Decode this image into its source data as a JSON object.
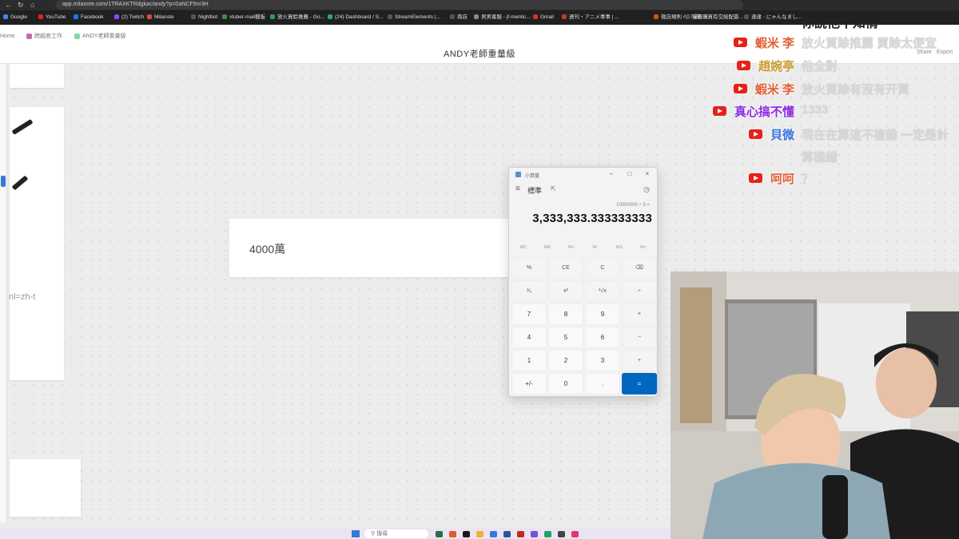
{
  "browser": {
    "url": "app.milanote.com/1TRAXKTRdgkac/andy?p=0aNCF5nr3H",
    "bookmarks": [
      "Google",
      "YouTube",
      "Facebook",
      "(2) Twitch",
      "Milanote",
      "Nightbot",
      "vtuber-mail模板",
      "放火買賒推薦 - Go...",
      "(24) Dashboard / S...",
      "StreamElements |...",
      "商店",
      "男男客服 - jf-mentic...",
      "Gmail",
      "週刊・アニメ事事 | ...",
      "微店規則 4.470年...",
      "漫畫購買有交給配簽...",
      "達達 - にゃんなまし..."
    ]
  },
  "app": {
    "breadcrumbs": [
      "Home",
      "跨組底工作",
      "ANDY老師重量級"
    ],
    "board_title": "ANDY老師重量級",
    "share_label": "Share",
    "export_label": "Export",
    "note_text": "4000萬",
    "left_partial_text": "nl=zh-t"
  },
  "calculator": {
    "title": "小算盤",
    "mode": "標準",
    "expression": "10000000 ÷ 3 =",
    "result": "3,333,333.333333333",
    "memory_keys": [
      "MC",
      "MR",
      "M+",
      "M-",
      "MS",
      "M˅"
    ],
    "keys": [
      [
        "%",
        "CE",
        "C",
        "⌫"
      ],
      [
        "¹⁄ₓ",
        "x²",
        "²√x",
        "÷"
      ],
      [
        "7",
        "8",
        "9",
        "×"
      ],
      [
        "4",
        "5",
        "6",
        "−"
      ],
      [
        "1",
        "2",
        "3",
        "+"
      ],
      [
        "+/-",
        "0",
        ".",
        "="
      ]
    ]
  },
  "chat": {
    "top_message": "你說他不知情",
    "messages": [
      {
        "name": "蝦米 李",
        "text": "放火買賒推薦 買賒太便宜",
        "name_color": "#e0603a"
      },
      {
        "name": "趙婉亭",
        "text": "他全對",
        "name_color": "#c99a2e"
      },
      {
        "name": "蝦米 李",
        "text": "放火買賒有沒有开買",
        "name_color": "#e0603a"
      },
      {
        "name": "真心搞不懂",
        "text": "1333",
        "name_color": "#8a2be2"
      },
      {
        "name": "貝微",
        "text": "現在在算這不複雜 一定是計",
        "text2": "算機錯",
        "name_color": "#3b73d9"
      },
      {
        "name": "呵呵",
        "text": "？",
        "name_color": "#e0603a"
      }
    ]
  },
  "taskbar": {
    "search_placeholder": "搜尋"
  }
}
